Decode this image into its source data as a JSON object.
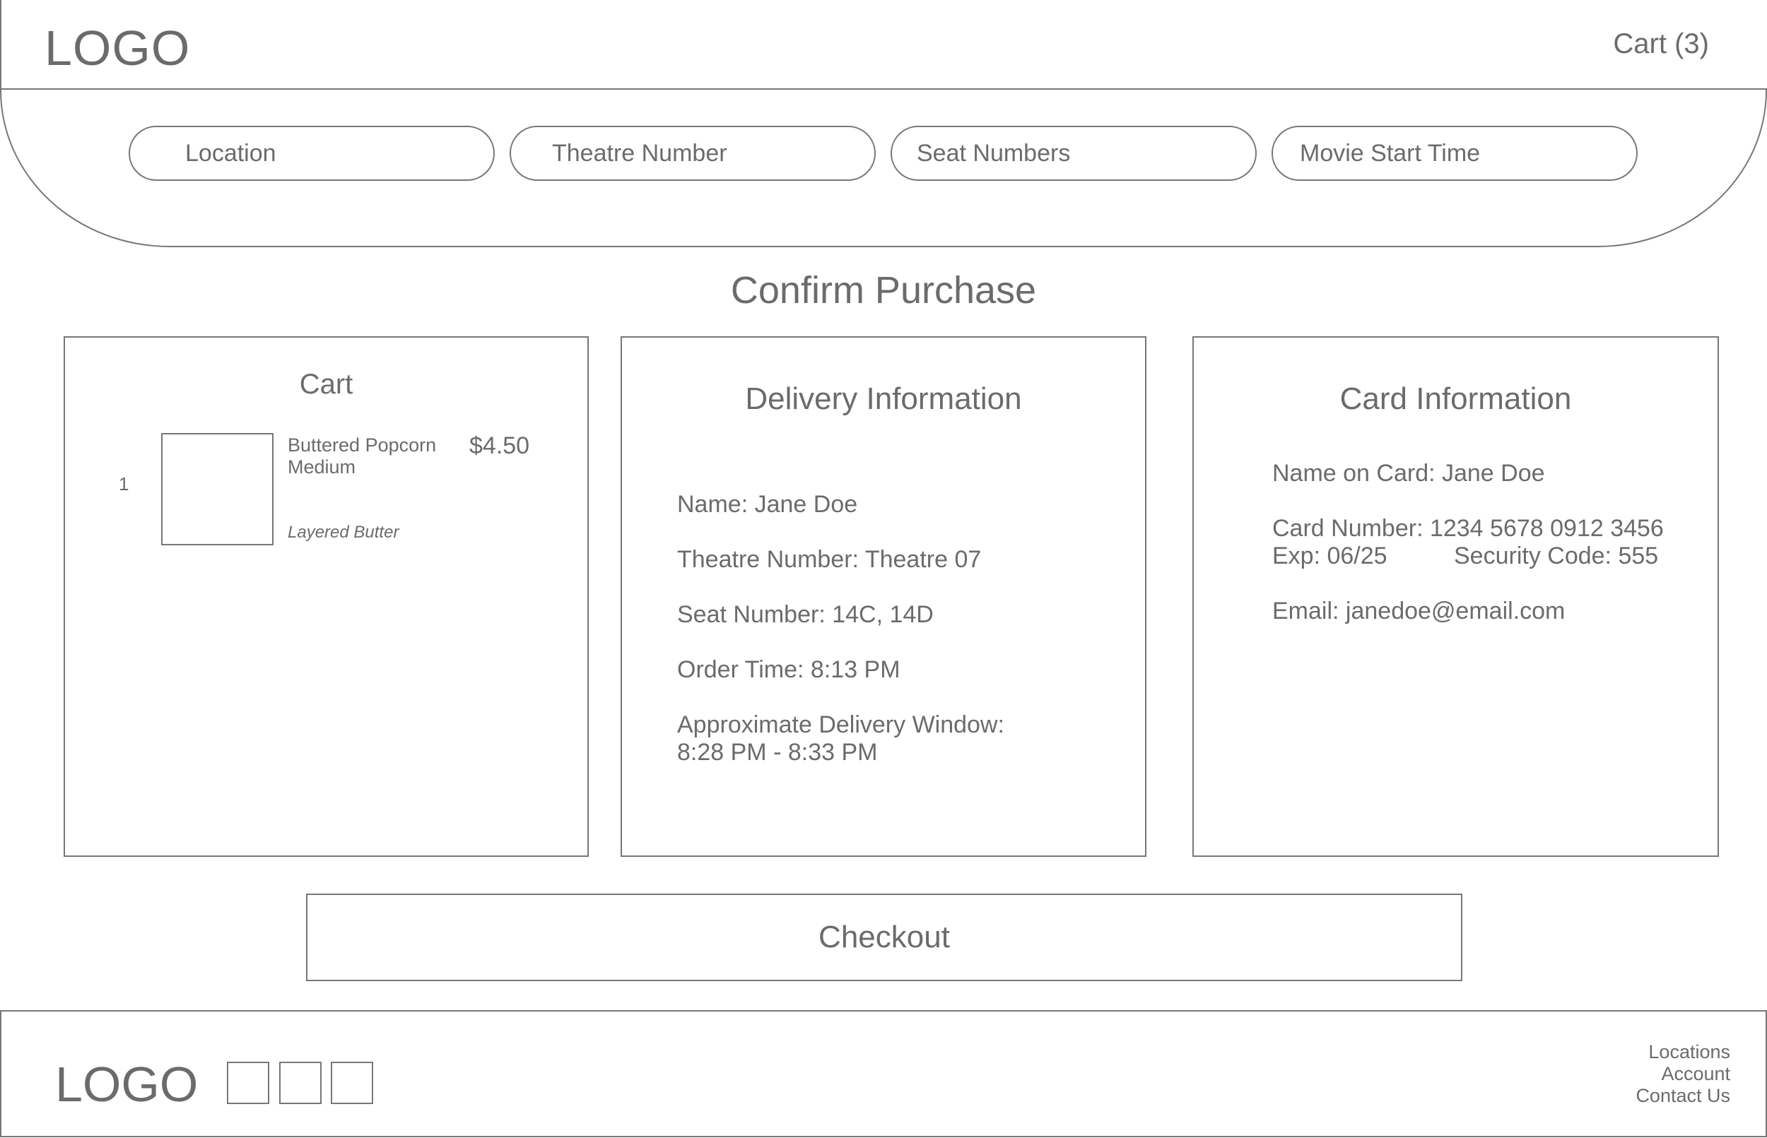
{
  "header": {
    "logo": "LOGO",
    "cart_label": "Cart (3)"
  },
  "filters": {
    "location_placeholder": "Location",
    "theatre_placeholder": "Theatre Number",
    "seats_placeholder": "Seat Numbers",
    "start_time_placeholder": "Movie Start Time"
  },
  "main": {
    "title": "Confirm Purchase"
  },
  "cart": {
    "title": "Cart",
    "items": [
      {
        "quantity": "1",
        "name": "Buttered Popcorn",
        "size": "Medium",
        "option": "Layered Butter",
        "price": "$4.50"
      }
    ]
  },
  "delivery": {
    "title": "Delivery Information",
    "name": "Name: Jane Doe",
    "theatre": "Theatre Number: Theatre 07",
    "seats": "Seat Number: 14C, 14D",
    "order_time": "Order Time: 8:13 PM",
    "window_label": "Approximate Delivery Window:",
    "window_value": "8:28 PM - 8:33 PM"
  },
  "card": {
    "title": "Card Information",
    "name": "Name on Card: Jane Doe",
    "number": "Card Number: 1234 5678 0912 3456",
    "exp": "Exp: 06/25",
    "security": "Security Code: 555",
    "email": "Email: janedoe@email.com"
  },
  "checkout_label": "Checkout",
  "footer": {
    "logo": "LOGO",
    "social_icons": [
      "social-icon-1",
      "social-icon-2",
      "social-icon-3"
    ],
    "links": [
      "Locations",
      "Account",
      "Contact Us"
    ]
  }
}
